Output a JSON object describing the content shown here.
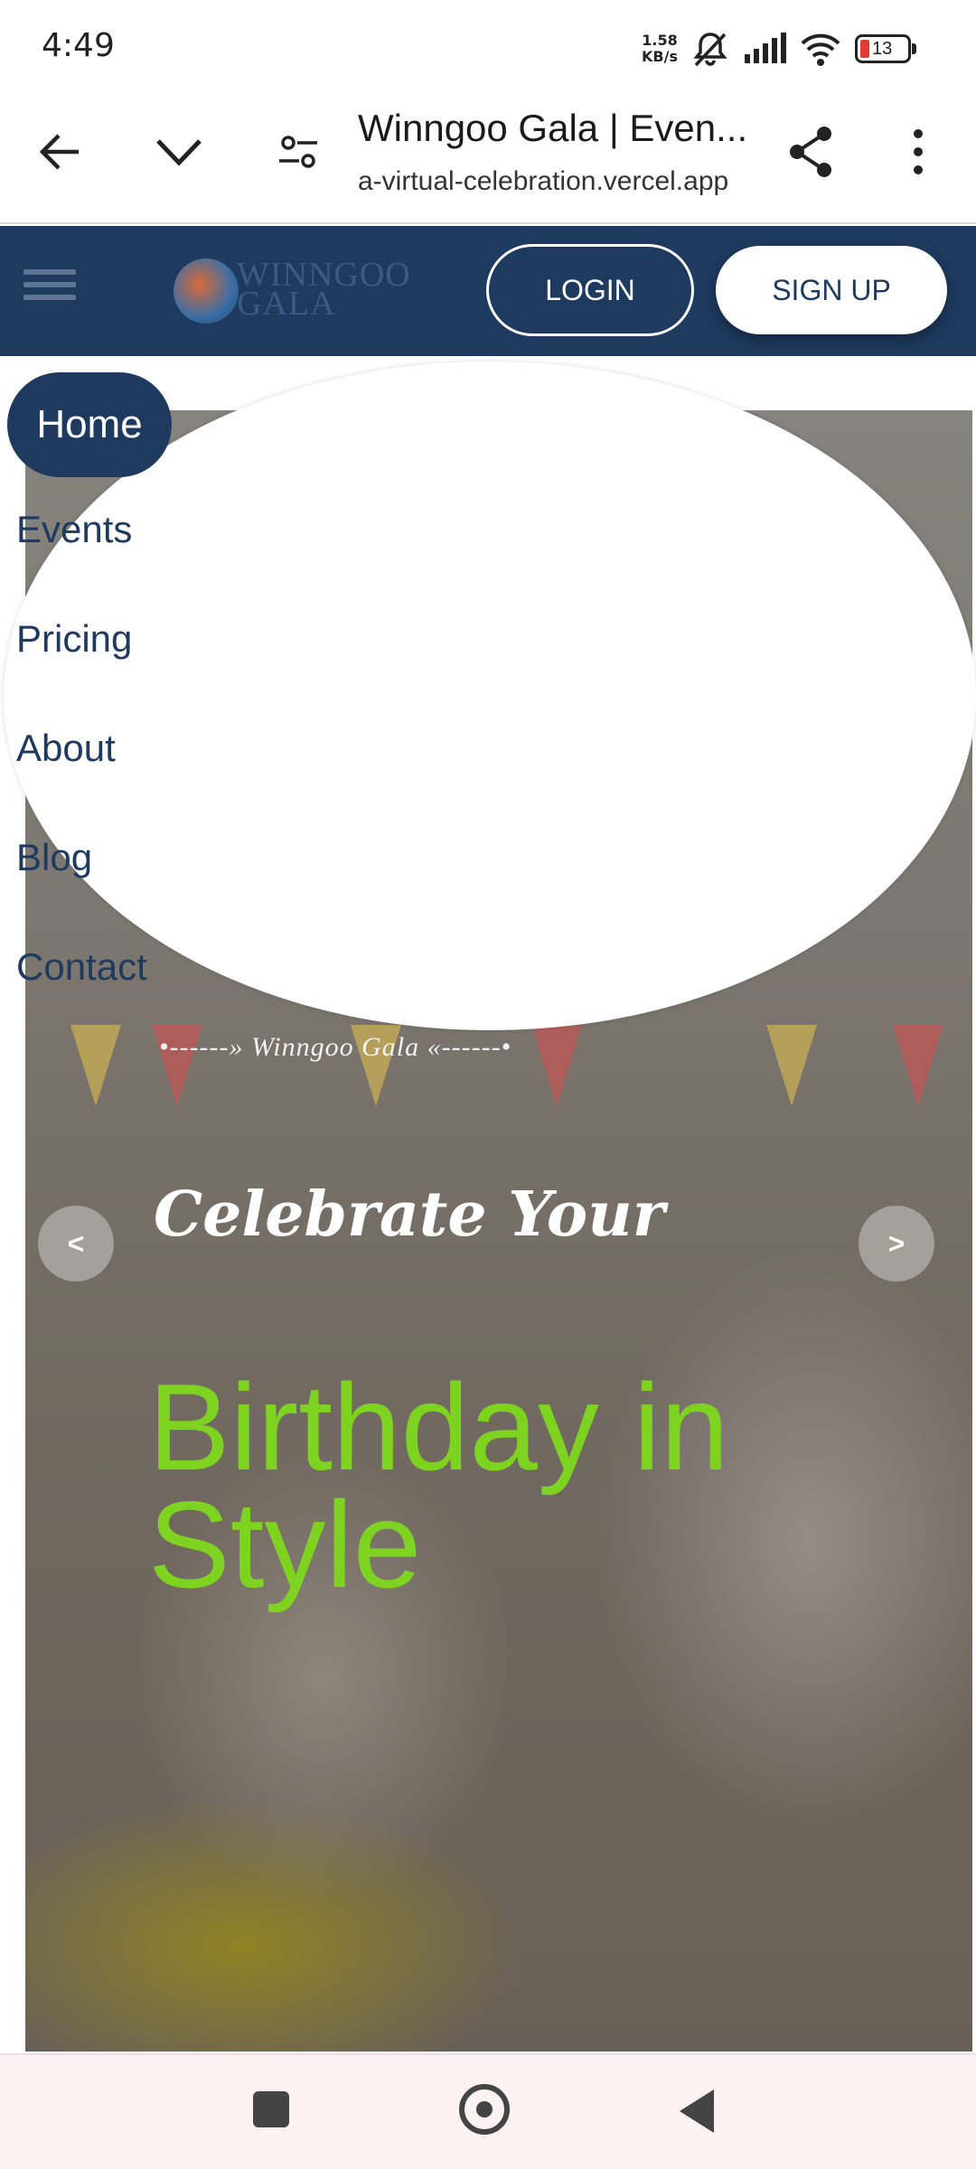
{
  "status_bar": {
    "time": "4:49",
    "net_speed_value": "1.58",
    "net_speed_unit": "KB/s",
    "battery_level": "13",
    "icons": [
      "muted-bell-icon",
      "signal-icon",
      "wifi-icon",
      "battery-icon"
    ]
  },
  "browser": {
    "page_title": "Winngoo Gala | Even...",
    "url": "a-virtual-celebration.vercel.app",
    "icons": [
      "back-arrow-icon",
      "chevron-down-icon",
      "tune-icon",
      "share-icon",
      "more-vert-icon"
    ]
  },
  "header": {
    "logo_line1": "WINNGOO",
    "logo_line2": "GALA",
    "login_label": "LOGIN",
    "signup_label": "SIGN UP"
  },
  "nav": {
    "items": [
      {
        "label": "Home",
        "active": true
      },
      {
        "label": "Events"
      },
      {
        "label": "Pricing"
      },
      {
        "label": "About"
      },
      {
        "label": "Blog"
      },
      {
        "label": "Contact"
      }
    ]
  },
  "hero": {
    "tagline": "•------» Winngoo Gala «------•",
    "script_text": "Celebrate Your",
    "headline": "Birthday in Style",
    "prev_label": "<",
    "next_label": ">"
  },
  "colors": {
    "brand_navy": "#1e3a5f",
    "headline_green": "#7ed321",
    "battery_low": "#e53935"
  }
}
